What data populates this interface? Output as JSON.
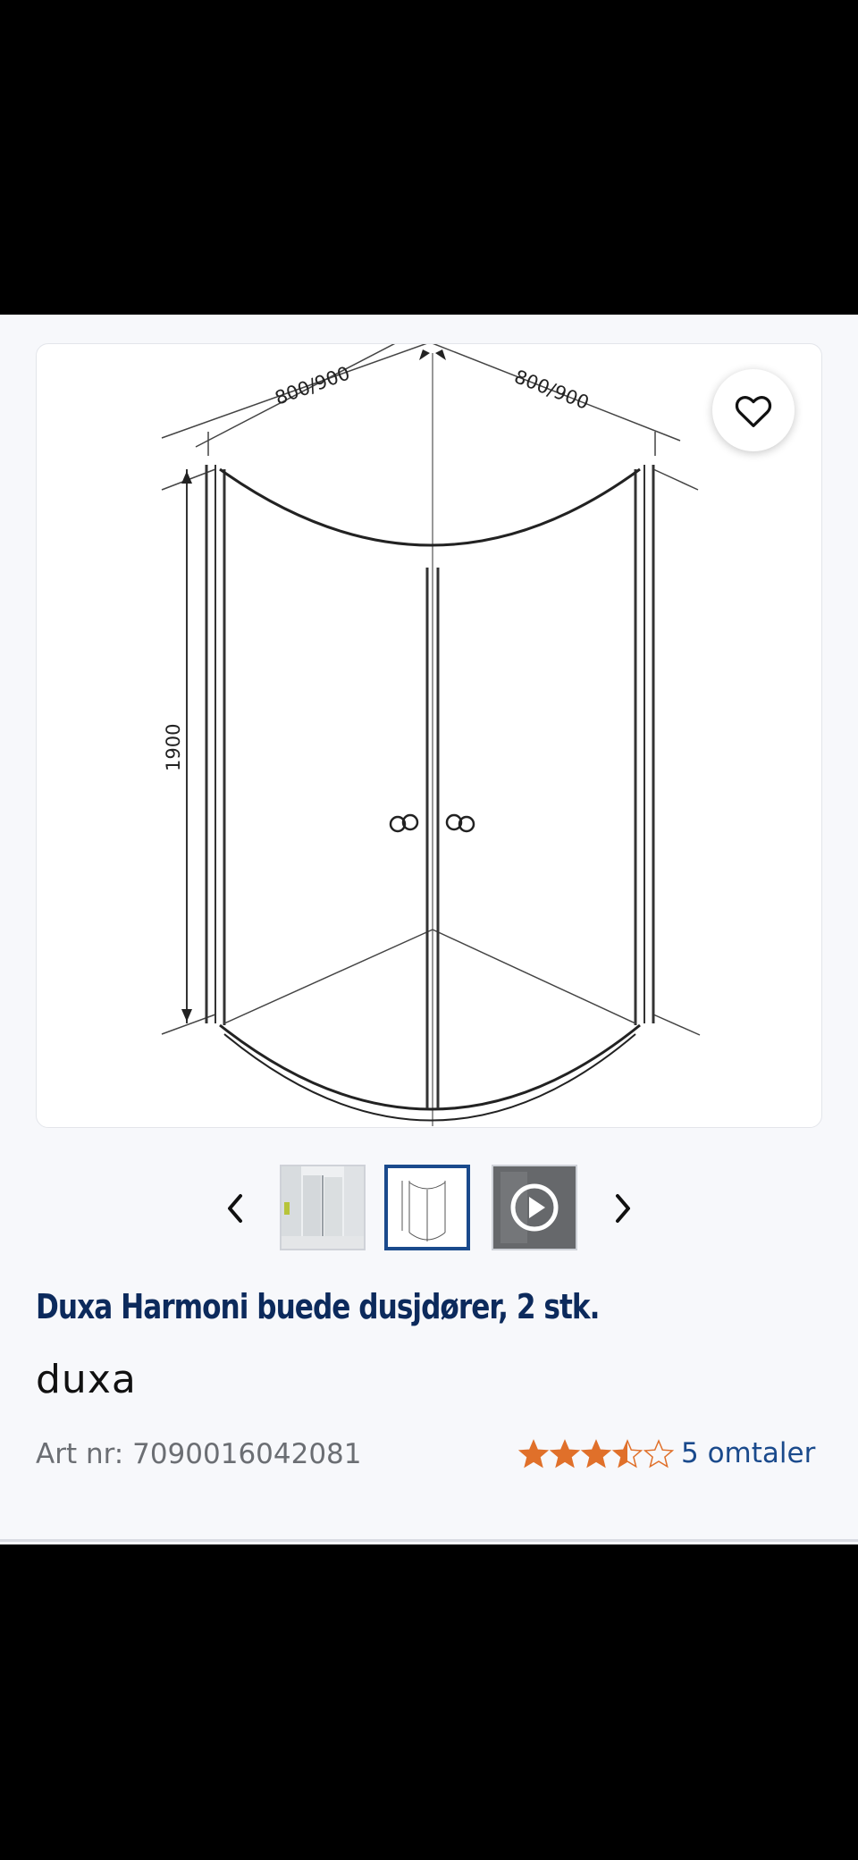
{
  "product": {
    "title": "Duxa Harmoni buede dusjdører, 2 stk.",
    "brand": "duxa",
    "art_nr": "Art nr: 7090016042081",
    "rating": 3.5,
    "rating_max": 5,
    "reviews_label": "5 omtaler"
  },
  "image": {
    "dim_width_left": "800/900",
    "dim_width_right": "800/900",
    "dim_height": "1900"
  },
  "gallery": {
    "thumbnails": [
      "photo",
      "drawing",
      "video"
    ],
    "selected_index": 1
  },
  "colors": {
    "title": "#0c2a5c",
    "link": "#1a4a8c",
    "star": "#e0702a",
    "selected_border": "#1a4a8c"
  },
  "icons": {
    "favorite": "heart-outline-icon",
    "prev": "chevron-left-icon",
    "next": "chevron-right-icon",
    "video": "play-circle-icon"
  }
}
